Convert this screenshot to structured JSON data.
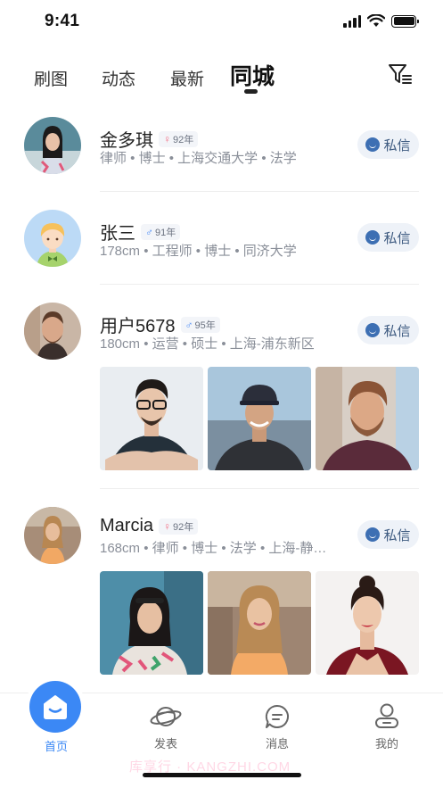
{
  "status_bar": {
    "time": "9:41"
  },
  "tabs": [
    {
      "label": "刷图",
      "active": false
    },
    {
      "label": "动态",
      "active": false
    },
    {
      "label": "最新",
      "active": false
    },
    {
      "label": "同城",
      "active": true
    }
  ],
  "posts": [
    {
      "name": "金多琪",
      "gender": "female",
      "gender_symbol": "♀",
      "age": "92年",
      "info": "律师 • 博士 • 上海交通大学 • 法学",
      "message_label": "私信"
    },
    {
      "name": "张三",
      "gender": "male",
      "gender_symbol": "♂",
      "age": "91年",
      "info": "178cm • 工程师 • 博士 • 同济大学",
      "message_label": "私信"
    },
    {
      "name": "用户5678",
      "gender": "male",
      "gender_symbol": "♂",
      "age": "95年",
      "info": "180cm • 运营 • 硕士 • 上海-浦东新区",
      "message_label": "私信"
    },
    {
      "name": "Marcia",
      "gender": "female",
      "gender_symbol": "♀",
      "age": "92年",
      "info": "168cm • 律师 • 博士 • 法学 • 上海-静…",
      "message_label": "私信"
    }
  ],
  "bottom_nav": [
    {
      "label": "首页",
      "icon": "home-icon",
      "active": true
    },
    {
      "label": "发表",
      "icon": "planet-icon",
      "active": false
    },
    {
      "label": "消息",
      "icon": "message-icon",
      "active": false
    },
    {
      "label": "我的",
      "icon": "profile-icon",
      "active": false
    }
  ],
  "watermark": "库享行 · KANGZHI.COM",
  "colors": {
    "accent": "#3b88f5",
    "message_button_bg": "#eef2f8",
    "female": "#f27489",
    "male": "#4f8ef7"
  }
}
